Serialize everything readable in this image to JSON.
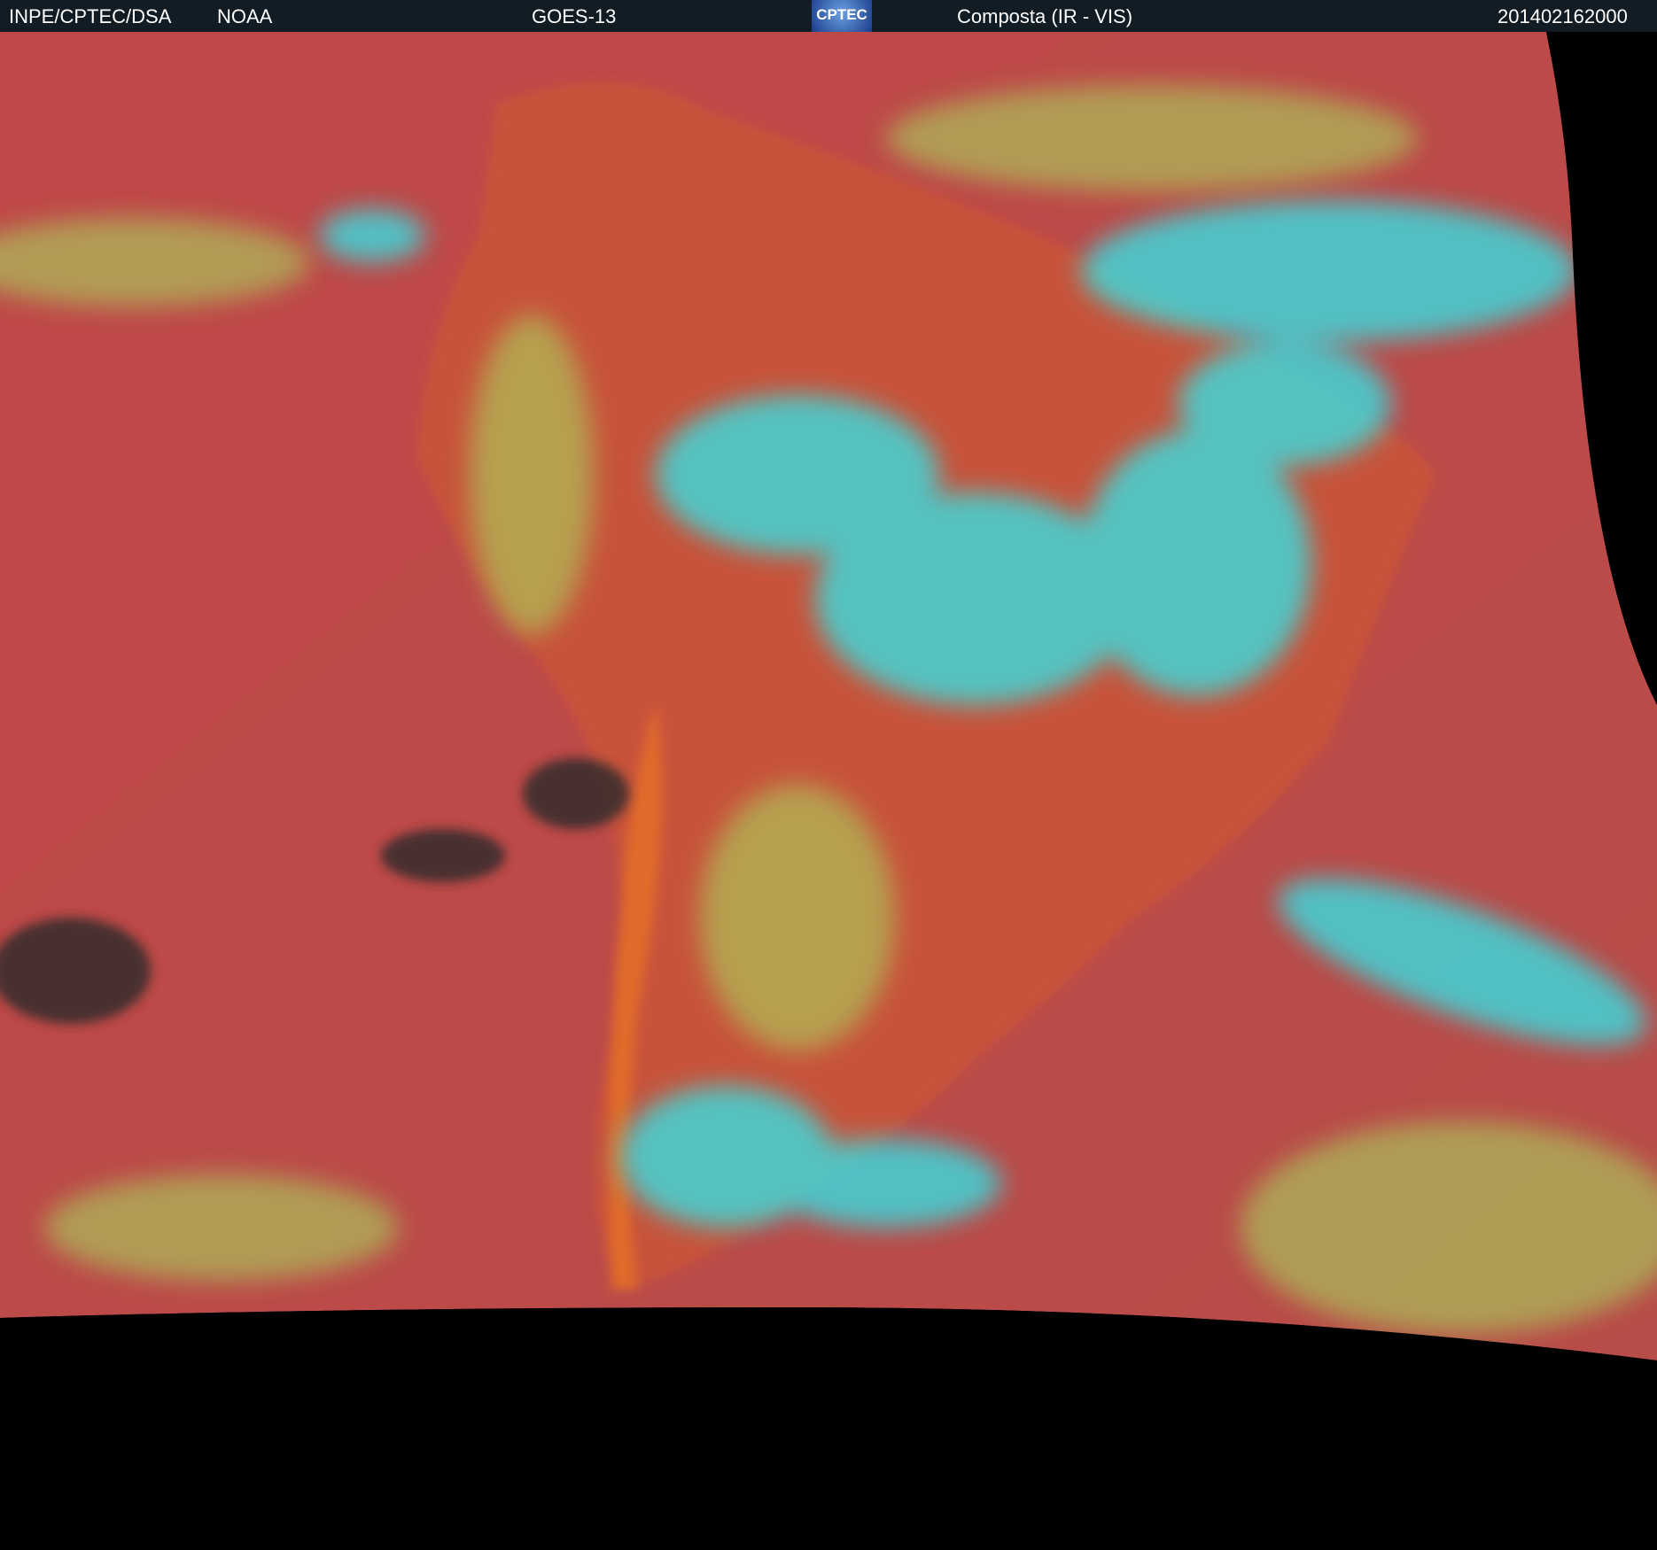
{
  "header": {
    "institution": "INPE/CPTEC/DSA",
    "agency": "NOAA",
    "satellite": "GOES-13",
    "logo_text": "CPTEC",
    "product": "Composta (IR - VIS)",
    "timestamp": "201402162000"
  },
  "colors": {
    "ocean": "#b84a4a",
    "land": "#d0582e",
    "cold_cloud": "#2ef0f0",
    "low_cloud": "#a8e060",
    "space": "#000000"
  }
}
